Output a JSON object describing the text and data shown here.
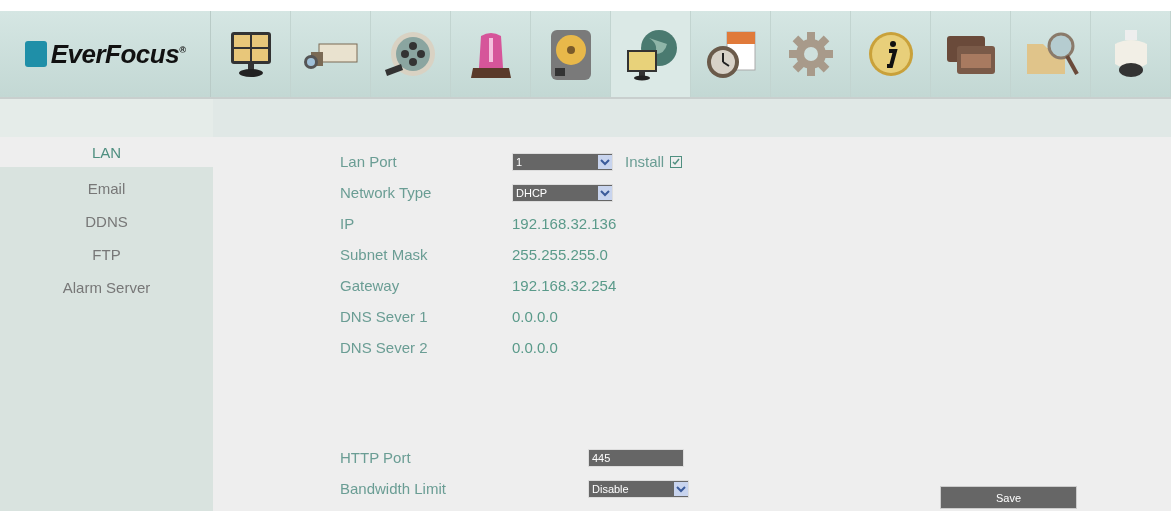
{
  "logo": {
    "text": "EverFocus",
    "mark": "®"
  },
  "nav_icons": [
    {
      "selected": false
    },
    {
      "selected": false
    },
    {
      "selected": false
    },
    {
      "selected": false
    },
    {
      "selected": false
    },
    {
      "selected": true
    },
    {
      "selected": false
    },
    {
      "selected": false
    },
    {
      "selected": false
    },
    {
      "selected": false
    },
    {
      "selected": false
    },
    {
      "selected": false
    }
  ],
  "sidebar": {
    "items": [
      {
        "label": "LAN",
        "selected": true
      },
      {
        "label": "Email",
        "selected": false
      },
      {
        "label": "DDNS",
        "selected": false
      },
      {
        "label": "FTP",
        "selected": false
      },
      {
        "label": "Alarm Server",
        "selected": false
      }
    ]
  },
  "network_fields": [
    {
      "label": "Lan Port",
      "kind": "select",
      "value": "1",
      "option": {
        "label": "Install",
        "checked": true
      }
    },
    {
      "label": "Network Type",
      "kind": "select",
      "value": "DHCP"
    },
    {
      "label": "IP",
      "kind": "text",
      "value": "192.168.32.136"
    },
    {
      "label": "Subnet Mask",
      "kind": "text",
      "value": "255.255.255.0"
    },
    {
      "label": "Gateway",
      "kind": "text",
      "value": "192.168.32.254"
    },
    {
      "label": "DNS Sever 1",
      "kind": "text",
      "value": "0.0.0.0"
    },
    {
      "label": "DNS Sever 2",
      "kind": "text",
      "value": "0.0.0.0"
    }
  ],
  "port_fields": [
    {
      "label": "HTTP Port",
      "kind": "input",
      "value": "445"
    },
    {
      "label": "Bandwidth Limit",
      "kind": "select",
      "value": "Disable"
    }
  ],
  "save_button": "Save"
}
